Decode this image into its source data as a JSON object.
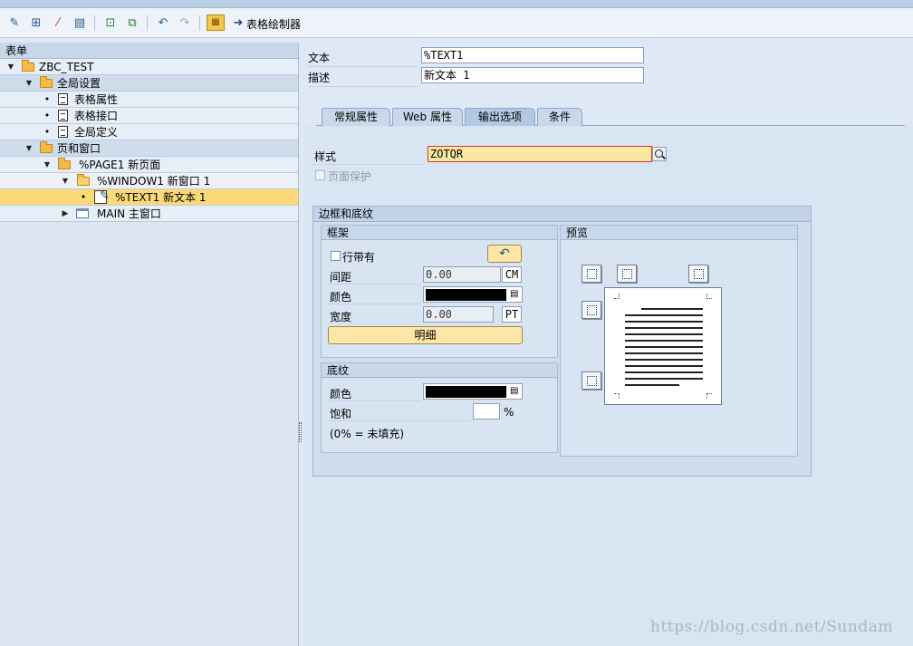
{
  "toolbar": {
    "icons": [
      "pencil-glasses-icon",
      "hierarchy-icon",
      "magic-wand-icon",
      "columns-icon",
      "insert-node-icon",
      "copy-node-icon",
      "undo-icon",
      "redo-icon",
      "table-painter-icon",
      "arrow-right-icon"
    ],
    "table_painter_label": "表格绘制器"
  },
  "tree": {
    "header": "表单",
    "nodes": [
      {
        "label": "ZBC_TEST"
      },
      {
        "label": "全局设置"
      },
      {
        "label": "表格属性"
      },
      {
        "label": "表格接口"
      },
      {
        "label": "全局定义"
      },
      {
        "label": "页和窗口"
      },
      {
        "label": "%PAGE1 新页面"
      },
      {
        "label": "%WINDOW1 新窗口 1"
      },
      {
        "label": "%TEXT1 新文本 1"
      },
      {
        "label": "MAIN 主窗口"
      }
    ]
  },
  "header_fields": {
    "text_label": "文本",
    "text_value": "%TEXT1",
    "desc_label": "描述",
    "desc_value": "新文本 1"
  },
  "tabs": [
    {
      "label": "常规属性"
    },
    {
      "label": "Web 属性"
    },
    {
      "label": "输出选项"
    },
    {
      "label": "条件"
    }
  ],
  "output_options": {
    "style_label": "样式",
    "style_value": "ZOTQR",
    "page_protect_label": "页面保护",
    "border_shading_title": "边框和底纹",
    "frame": {
      "title": "框架",
      "row_with_label": "行带有",
      "spacing_label": "间距",
      "spacing_value": "0.00",
      "spacing_unit": "CM",
      "color_label": "颜色",
      "width_label": "宽度",
      "width_value": "0.00",
      "width_unit": "PT",
      "detail_button": "明细"
    },
    "shading": {
      "title": "底纹",
      "color_label": "颜色",
      "saturation_label": "饱和",
      "saturation_value": "",
      "percent_sign": "%",
      "note": "(0% = 未填充)"
    },
    "preview": {
      "title": "预览"
    }
  },
  "colors": {
    "selection": "#fbd978",
    "style_field": "#fbe8a0",
    "button_yellow": "#fde6a6",
    "panel_blue": "#d9e5f2"
  },
  "watermark": "https://blog.csdn.net/Sundam"
}
